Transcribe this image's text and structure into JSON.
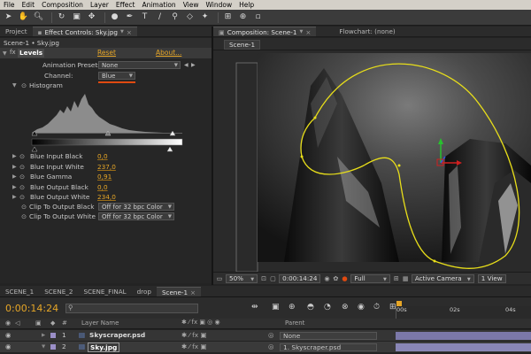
{
  "menu": [
    "File",
    "Edit",
    "Composition",
    "Layer",
    "Effect",
    "Animation",
    "View",
    "Window",
    "Help"
  ],
  "left_tabs": [
    "Project",
    "Effect Controls: Sky.jpg"
  ],
  "effect_controls": {
    "subtitle": "Scene-1 • Sky.jpg",
    "effect_name": "Levels",
    "reset": "Reset",
    "about": "About...",
    "presets_label": "Animation Presets:",
    "presets_value": "None",
    "channel_label": "Channel:",
    "channel_value": "Blue",
    "histogram_label": "Histogram",
    "properties": [
      {
        "label": "Blue Input Black",
        "value": "0,0"
      },
      {
        "label": "Blue Input White",
        "value": "237,0"
      },
      {
        "label": "Blue Gamma",
        "value": "0,91"
      },
      {
        "label": "Blue Output Black",
        "value": "0,0"
      },
      {
        "label": "Blue Output White",
        "value": "234,0"
      }
    ],
    "clip_black_label": "Clip To Output Black",
    "clip_black_value": "Off for 32 bpc Color",
    "clip_white_label": "Clip To Output White",
    "clip_white_value": "Off for 32 bpc Color"
  },
  "comp_tabs": [
    "Composition: Scene-1",
    "Flowchart: (none)"
  ],
  "comp_subtab": "Scene-1",
  "comp_footer": {
    "zoom": "50%",
    "timecode": "0:00:14:24",
    "resolution": "Full",
    "camera": "Active Camera",
    "view": "1 View"
  },
  "timeline": {
    "tabs": [
      "SCENE_1",
      "SCENE_2",
      "SCENE_FINAL",
      "drop",
      "Scene-1"
    ],
    "active_tab": "Scene-1",
    "timecode": "0:00:14:24",
    "search_placeholder": "",
    "col_num": "#",
    "col_layer": "Layer Name",
    "col_parent": "Parent",
    "ruler": [
      "00s",
      "02s",
      "04s"
    ],
    "layers": [
      {
        "num": "1",
        "name": "Skyscraper.psd",
        "parent": "None"
      },
      {
        "num": "2",
        "name": "Sky.jpg",
        "parent": "1. Skyscraper.psd"
      }
    ]
  },
  "colors": {
    "accent_orange": "#e6a627",
    "path_yellow": "#e8de1a",
    "channel_underline": "#e04a10"
  }
}
